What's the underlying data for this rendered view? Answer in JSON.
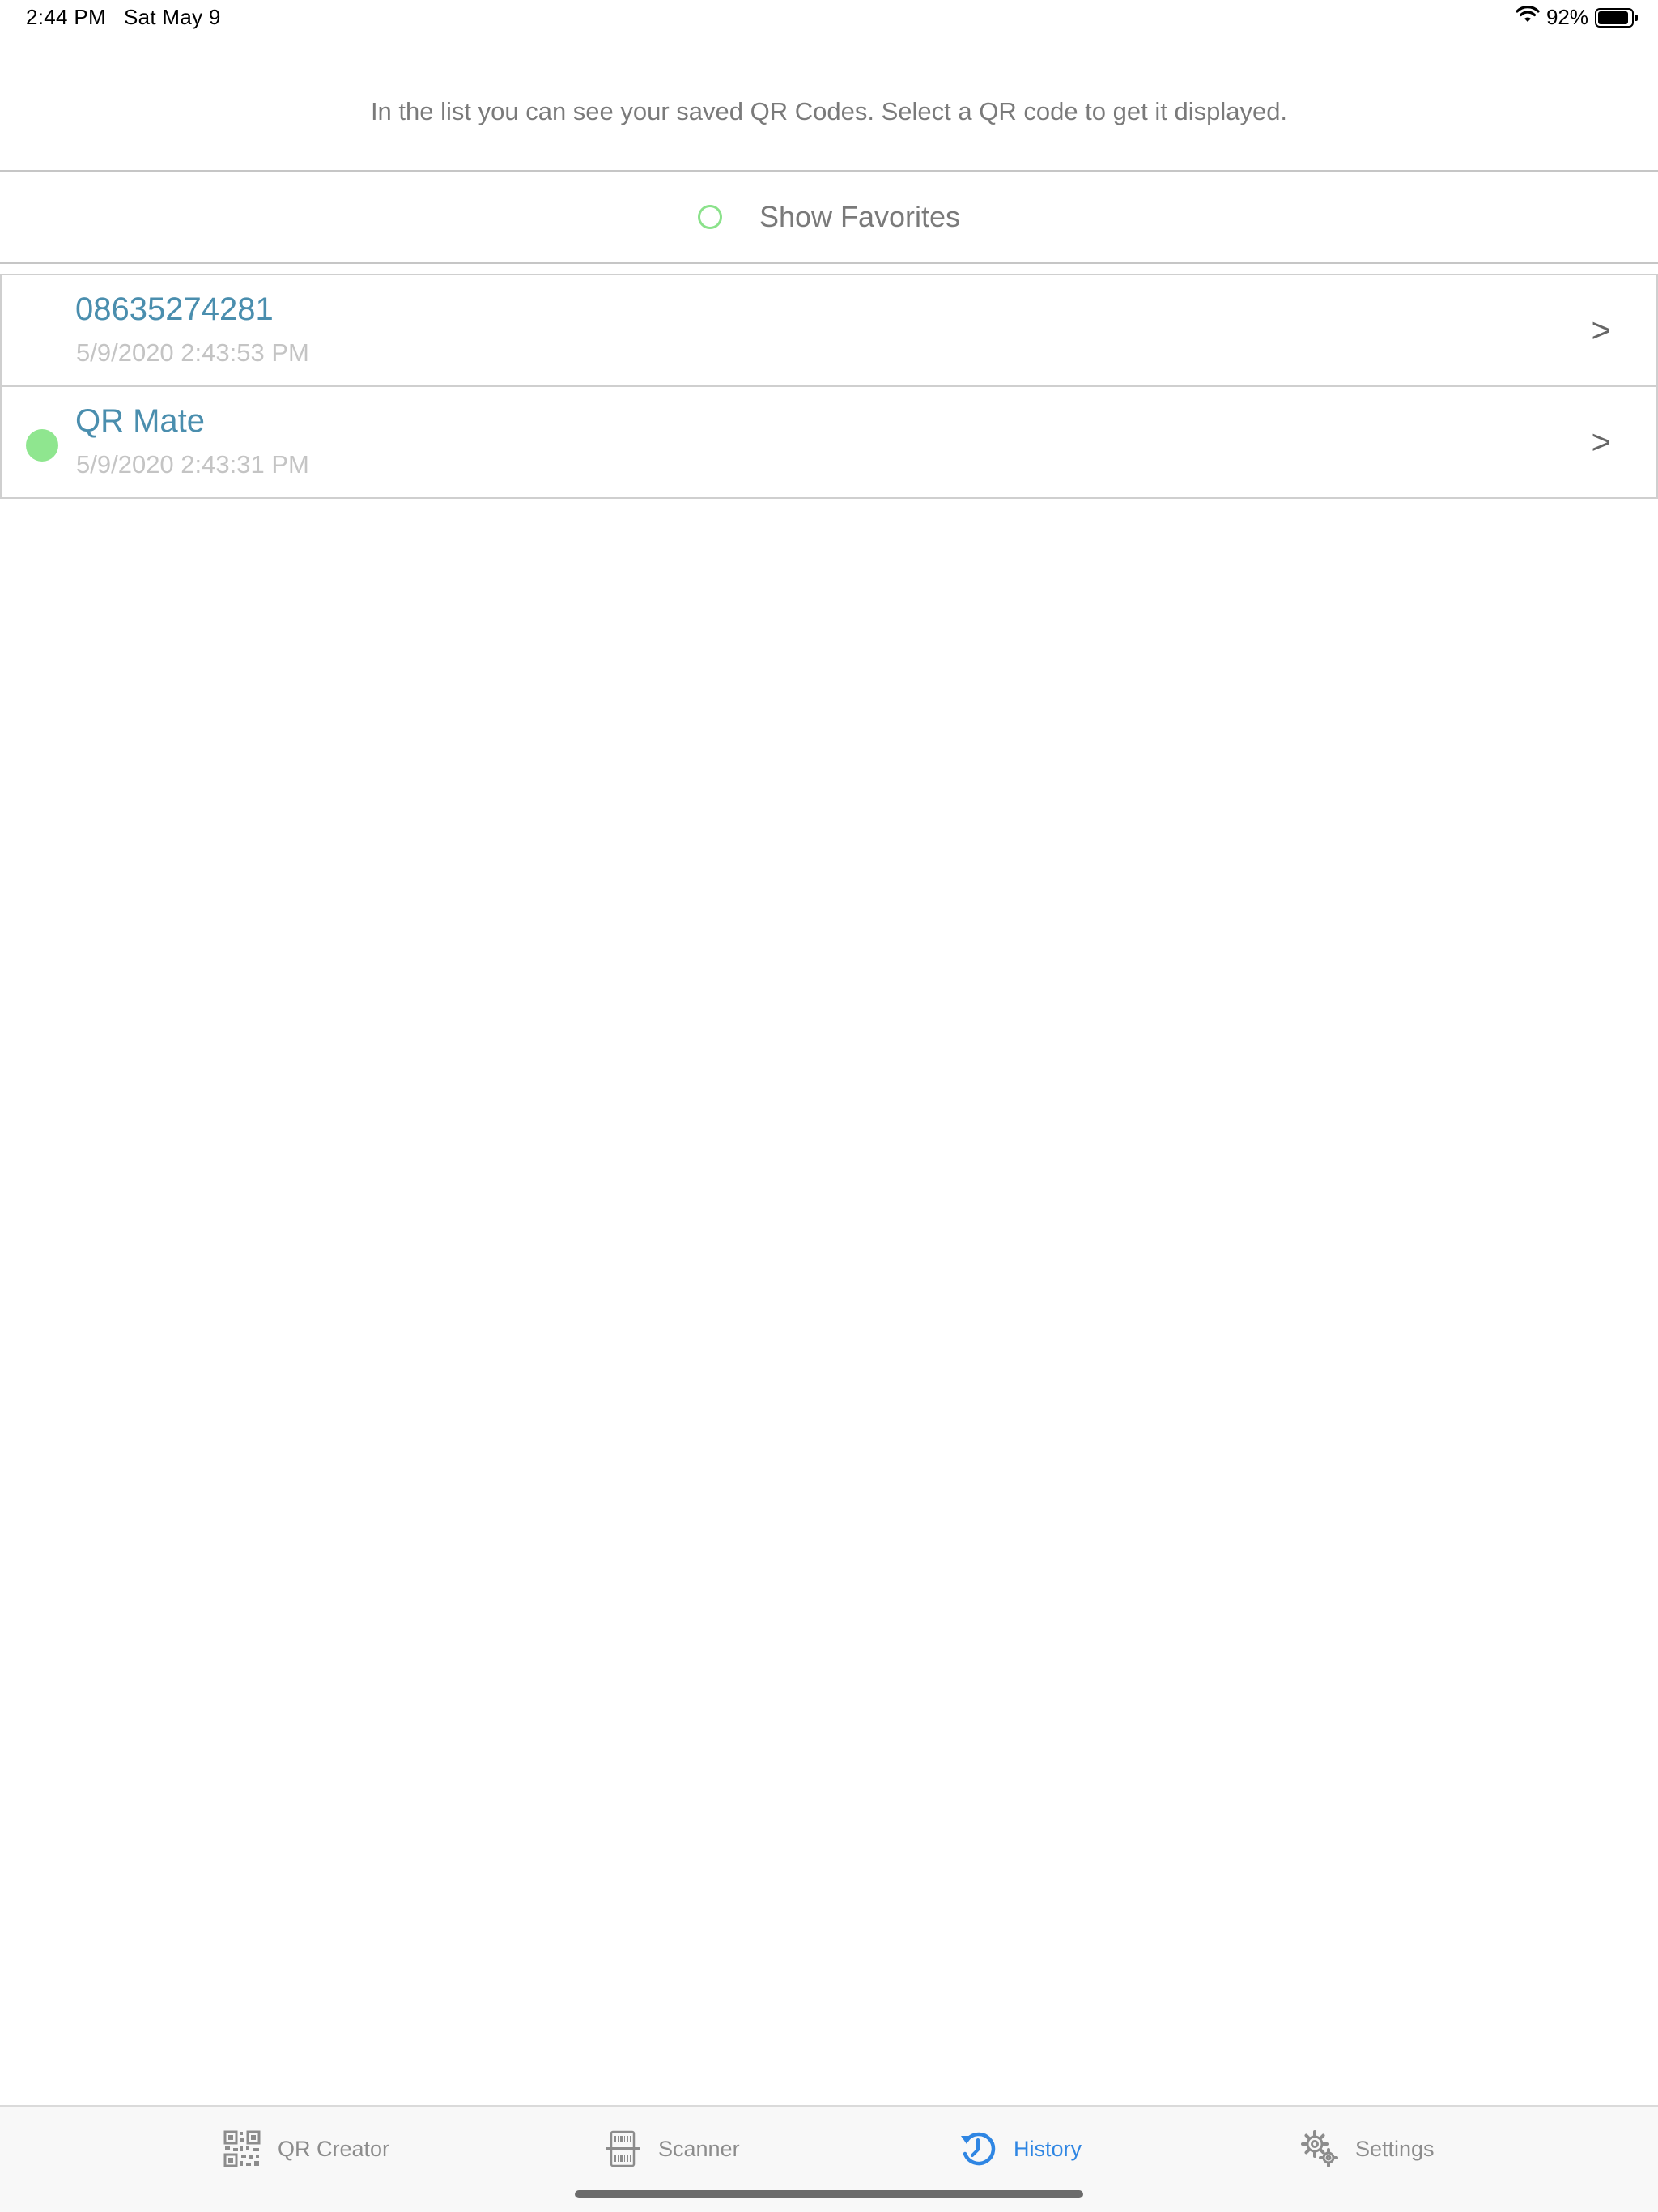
{
  "status_bar": {
    "time": "2:44 PM",
    "date": "Sat May 9",
    "battery_percent": "92%",
    "battery_level": 0.92
  },
  "description": "In the list you can see your saved QR Codes. Select a QR code to get it displayed.",
  "favorites_toggle": {
    "label": "Show Favorites",
    "selected": false,
    "color": "#8be28b"
  },
  "history": {
    "items": [
      {
        "title": "08635274281",
        "timestamp": "5/9/2020 2:43:53 PM",
        "favorite": false,
        "chevron": ">"
      },
      {
        "title": "QR Mate",
        "timestamp": "5/9/2020 2:43:31 PM",
        "favorite": true,
        "chevron": ">"
      }
    ]
  },
  "tab_bar": {
    "active_color": "#2f86e3",
    "inactive_color": "#8c8c8c",
    "tabs": [
      {
        "label": "QR Creator",
        "icon": "qr-code-icon",
        "active": false
      },
      {
        "label": "Scanner",
        "icon": "barcode-scanner-icon",
        "active": false
      },
      {
        "label": "History",
        "icon": "history-clock-icon",
        "active": true
      },
      {
        "label": "Settings",
        "icon": "gears-icon",
        "active": false
      }
    ]
  }
}
